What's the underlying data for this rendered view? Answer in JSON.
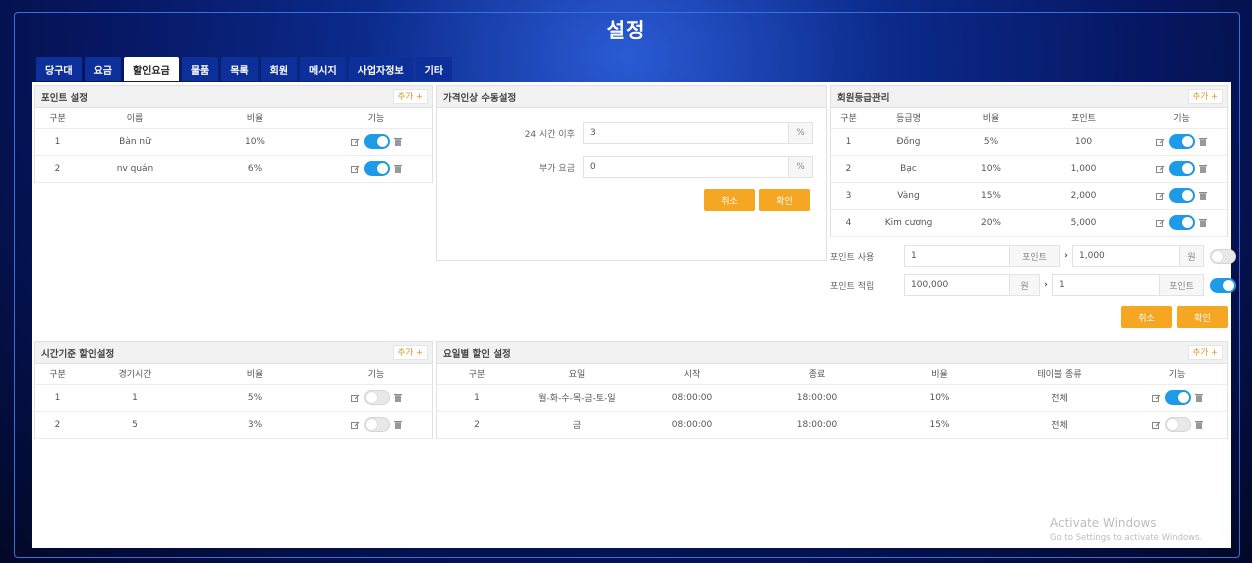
{
  "window": {
    "title": "설정"
  },
  "tabs": [
    {
      "label": "당구대",
      "active": false
    },
    {
      "label": "요금",
      "active": false
    },
    {
      "label": "할인요금",
      "active": true
    },
    {
      "label": "물품",
      "active": false
    },
    {
      "label": "목록",
      "active": false
    },
    {
      "label": "회원",
      "active": false
    },
    {
      "label": "메시지",
      "active": false
    },
    {
      "label": "사업자정보",
      "active": false
    },
    {
      "label": "기타",
      "active": false
    }
  ],
  "point_settings": {
    "title": "포인트 설정",
    "add_label": "추가 +",
    "columns": [
      "구분",
      "이름",
      "비율",
      "기능"
    ],
    "rows": [
      {
        "no": "1",
        "name": "Bàn nữ",
        "rate": "10%",
        "enabled": true
      },
      {
        "no": "2",
        "name": "nv quán",
        "rate": "6%",
        "enabled": true
      }
    ]
  },
  "manual_price": {
    "title": "가격인상 수동설정",
    "fields": [
      {
        "label": "24 시간 이후",
        "value": "3",
        "unit": "%"
      },
      {
        "label": "부가 요금",
        "value": "0",
        "unit": "%"
      }
    ],
    "cancel_label": "취소",
    "confirm_label": "확인"
  },
  "member_grade": {
    "title": "회원등급관리",
    "add_label": "추가 +",
    "columns": [
      "구분",
      "등급명",
      "비율",
      "포인트",
      "기능"
    ],
    "rows": [
      {
        "no": "1",
        "name": "Đồng",
        "rate": "5%",
        "points": "100",
        "enabled": true
      },
      {
        "no": "2",
        "name": "Bạc",
        "rate": "10%",
        "points": "1,000",
        "enabled": true
      },
      {
        "no": "3",
        "name": "Vàng",
        "rate": "15%",
        "points": "2,000",
        "enabled": true
      },
      {
        "no": "4",
        "name": "Kim cương",
        "rate": "20%",
        "points": "5,000",
        "enabled": true
      }
    ],
    "point_use": {
      "label": "포인트 사용",
      "value1": "1",
      "unit1": "포인트",
      "value2": "1,000",
      "unit2": "원",
      "enabled": false
    },
    "point_earn": {
      "label": "포인트 적립",
      "value1": "100,000",
      "unit1": "원",
      "value2": "1",
      "unit2": "포인트",
      "enabled": true
    },
    "cancel_label": "취소",
    "confirm_label": "확인"
  },
  "time_discount": {
    "title": "시간기준 할인설정",
    "add_label": "추가 +",
    "columns": [
      "구분",
      "경기시간",
      "비율",
      "기능"
    ],
    "rows": [
      {
        "no": "1",
        "time": "1",
        "rate": "5%",
        "enabled": false
      },
      {
        "no": "2",
        "time": "5",
        "rate": "3%",
        "enabled": false
      }
    ]
  },
  "day_discount": {
    "title": "요일별 할인 설정",
    "add_label": "추가 +",
    "columns": [
      "구분",
      "요일",
      "시작",
      "종료",
      "비율",
      "테이블 종류",
      "기능"
    ],
    "rows": [
      {
        "no": "1",
        "days": "월-화-수-목-금-토-일",
        "start": "08:00:00",
        "end": "18:00:00",
        "rate": "10%",
        "table_type": "전체",
        "enabled": true
      },
      {
        "no": "2",
        "days": "금",
        "start": "08:00:00",
        "end": "18:00:00",
        "rate": "15%",
        "table_type": "전체",
        "enabled": false
      }
    ]
  },
  "watermark": {
    "line1": "Activate Windows",
    "line2": "Go to Settings to activate Windows."
  },
  "colors": {
    "accent": "#1e9be8",
    "button_orange": "#f5a623",
    "tab_blue": "#0d2f9a"
  }
}
